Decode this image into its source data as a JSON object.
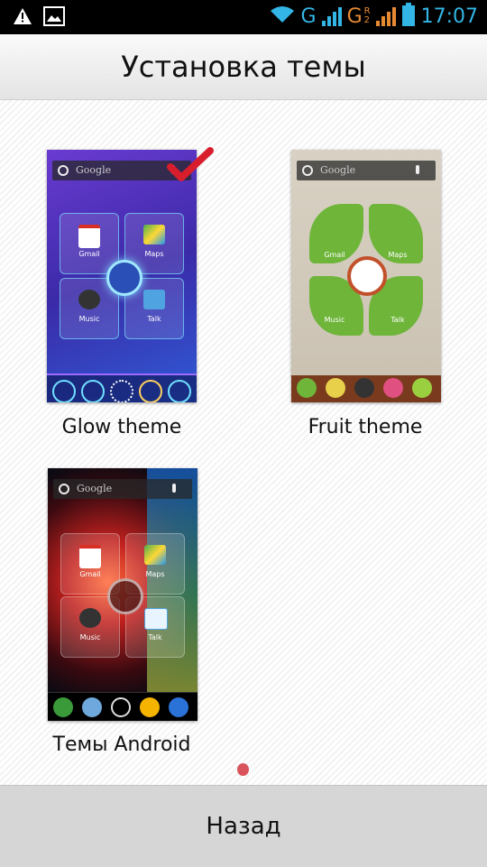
{
  "status_bar": {
    "time": "17:07",
    "network_g1": "G",
    "network_g2": "G",
    "roaming": "R",
    "sim2": "2"
  },
  "header": {
    "title": "Установка темы"
  },
  "themes": [
    {
      "label": "Glow theme",
      "selected": true
    },
    {
      "label": "Fruit theme",
      "selected": false
    },
    {
      "label": "Темы Android",
      "selected": false
    }
  ],
  "preview": {
    "search_text": "Google",
    "apps": [
      "Gmail",
      "Maps",
      "Music",
      "Talk"
    ]
  },
  "footer": {
    "back_label": "Назад"
  },
  "colors": {
    "accent": "#33b5e5",
    "roaming": "#e58a33",
    "check": "#d81d2c"
  }
}
